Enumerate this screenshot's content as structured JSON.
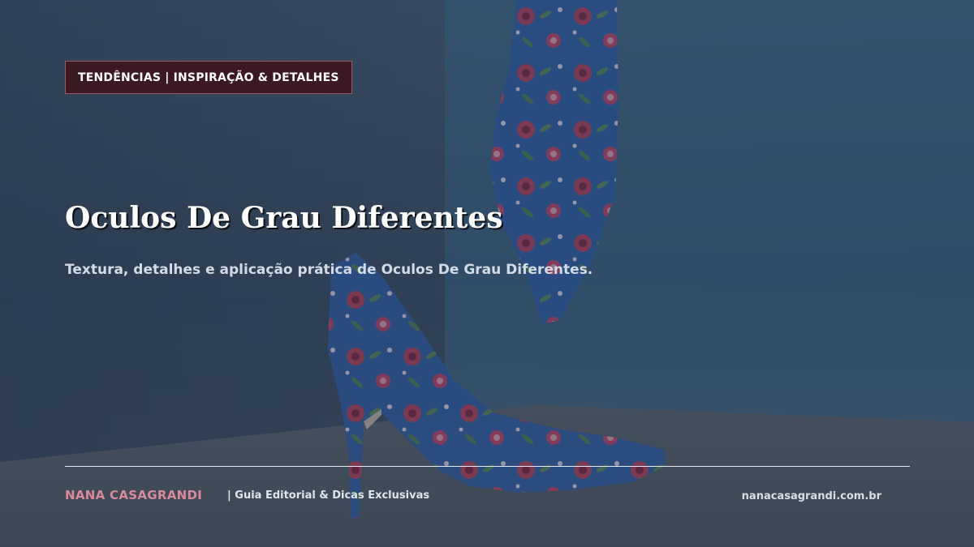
{
  "badge": {
    "label": "TENDÊNCIAS | INSPIRAÇÃO & DETALHES"
  },
  "hero": {
    "title": "Oculos De Grau Diferentes",
    "subtitle": "Textura, detalhes e aplicação prática de Oculos De Grau Diferentes."
  },
  "footer": {
    "brand": "NANA CASAGRANDI",
    "tagline": "|  Guia Editorial & Dicas Exclusivas",
    "site": "nanacasagrandi.com.br"
  },
  "colors": {
    "badge_bg": "#3b1822",
    "brand": "#d88a9a",
    "shoe_blue": "#2f5fa8",
    "flower_pink": "#c2436a"
  },
  "background": {
    "image": "floral-high-heels-photo"
  }
}
